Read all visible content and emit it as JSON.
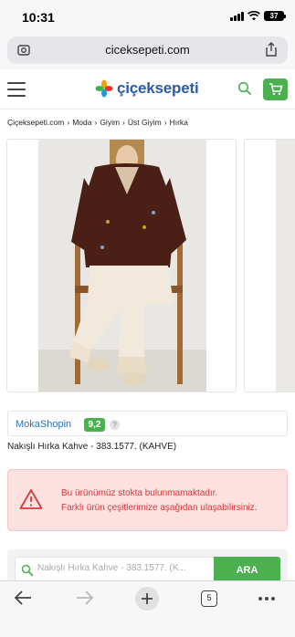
{
  "status_bar": {
    "time": "10:31",
    "battery": "37"
  },
  "browser": {
    "url": "ciceksepeti.com",
    "tab_count": "5"
  },
  "site": {
    "logo_text": "çiçeksepeti"
  },
  "breadcrumb": [
    "Çiçeksepeti.com",
    "Moda",
    "Giyim",
    "Üst Giyim",
    "Hırka"
  ],
  "seller": {
    "name": "MokaShopin",
    "score": "9,2",
    "help": "?"
  },
  "product": {
    "name": "Nakışlı Hırka Kahve - 383.1577. (KAHVE)"
  },
  "stock_alert": {
    "line1": "Bu ürünümüz stokta bulunmamaktadır.",
    "line2": "Farklı ürün çeşitlerimize aşağıdan ulaşabilirsiniz."
  },
  "search": {
    "placeholder": "Nakışlı Hırka Kahve - 383.1577. (K...",
    "button": "ARA"
  },
  "colors": {
    "brand_green": "#4caf50",
    "brand_blue": "#2b5aa6",
    "alert_red": "#d93a3a",
    "alert_bg": "#fde0e0"
  }
}
